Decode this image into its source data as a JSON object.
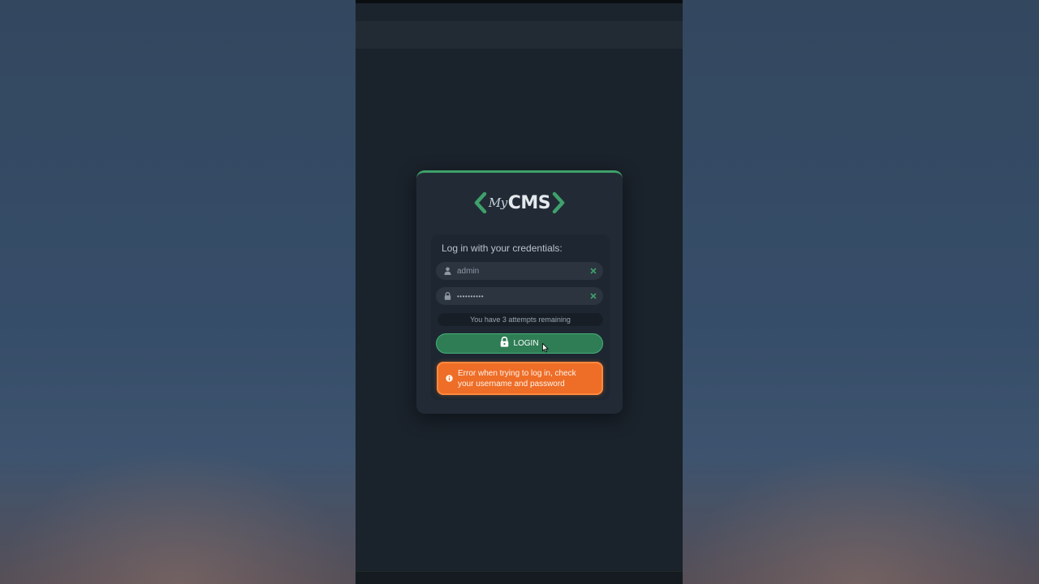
{
  "app": {
    "logo_prefix": "My",
    "logo_main": "CMS",
    "accent_color": "#3fa06b"
  },
  "login_form": {
    "title": "Log in with your credentials:",
    "username": {
      "value": "admin",
      "icon": "user-icon",
      "clear_icon": "close-icon"
    },
    "password": {
      "value": "••••••••••",
      "icon": "lock-icon",
      "clear_icon": "close-icon"
    },
    "attempts_text": "You have 3 attempts remaining",
    "login_button": {
      "label": "LOGIN",
      "icon": "lock-open-icon",
      "color": "#2e7d55"
    },
    "error": {
      "message": "Error when trying to log in, check your username and password",
      "icon": "info-icon",
      "color": "#ee6d27"
    }
  }
}
